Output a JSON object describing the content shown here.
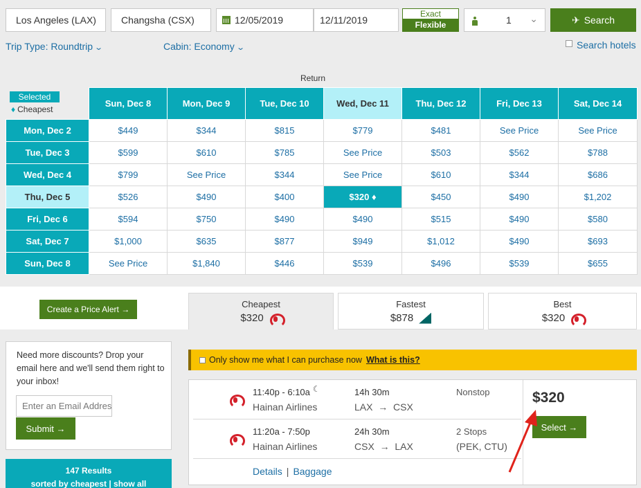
{
  "search": {
    "origin": "Los Angeles (LAX)",
    "destination": "Changsha (CSX)",
    "depart_date": "12/05/2019",
    "return_date": "12/11/2019",
    "exact_label": "Exact",
    "flexible_label": "Flexible",
    "passengers": "1",
    "search_label": "Search"
  },
  "options": {
    "trip_type": "Trip Type: Roundtrip",
    "cabin": "Cabin: Economy",
    "hotels": "Search hotels"
  },
  "grid": {
    "return_label": "Return",
    "selected_label": "Selected",
    "cheapest_label": "Cheapest",
    "columns": [
      "Sun, Dec 8",
      "Mon, Dec 9",
      "Tue, Dec 10",
      "Wed, Dec 11",
      "Thu, Dec 12",
      "Fri, Dec 13",
      "Sat, Dec 14"
    ],
    "rows": [
      {
        "label": "Mon, Dec 2",
        "cells": [
          "$449",
          "$344",
          "$815",
          "$779",
          "$481",
          "See Price",
          "See Price"
        ]
      },
      {
        "label": "Tue, Dec 3",
        "cells": [
          "$599",
          "$610",
          "$785",
          "See Price",
          "$503",
          "$562",
          "$788"
        ]
      },
      {
        "label": "Wed, Dec 4",
        "cells": [
          "$799",
          "See Price",
          "$344",
          "See Price",
          "$610",
          "$344",
          "$686"
        ]
      },
      {
        "label": "Thu, Dec 5",
        "cells": [
          "$526",
          "$490",
          "$400",
          "$320",
          "$450",
          "$490",
          "$1,202"
        ]
      },
      {
        "label": "Fri, Dec 6",
        "cells": [
          "$594",
          "$750",
          "$490",
          "$490",
          "$515",
          "$490",
          "$580"
        ]
      },
      {
        "label": "Sat, Dec 7",
        "cells": [
          "$1,000",
          "$635",
          "$877",
          "$949",
          "$1,012",
          "$490",
          "$693"
        ]
      },
      {
        "label": "Sun, Dec 8",
        "cells": [
          "See Price",
          "$1,840",
          "$446",
          "$539",
          "$496",
          "$539",
          "$655"
        ]
      }
    ]
  },
  "price_alert": "Create a Price Alert",
  "sort_tabs": [
    {
      "label": "Cheapest",
      "price": "$320",
      "logo": "hainan-logo"
    },
    {
      "label": "Fastest",
      "price": "$878",
      "logo": "cathay-logo"
    },
    {
      "label": "Best",
      "price": "$320",
      "logo": "hainan-logo"
    }
  ],
  "discount": {
    "text": "Need more discounts? Drop your email here and we'll send them right to your inbox!",
    "email_placeholder": "Enter an Email Address",
    "submit": "Submit"
  },
  "results": {
    "count": "147 Results",
    "sorted": "sorted by cheapest | show all"
  },
  "purchase": {
    "text": "Only show me what I can purchase now",
    "link": "What is this?"
  },
  "flight": {
    "legs": [
      {
        "time": "11:40p - 6:10a",
        "airline": "Hainan Airlines",
        "duration": "14h 30m",
        "route_from": "LAX",
        "route_to": "CSX",
        "stops": "Nonstop",
        "stops_detail": ""
      },
      {
        "time": "11:20a - 7:50p",
        "airline": "Hainan Airlines",
        "duration": "24h 30m",
        "route_from": "CSX",
        "route_to": "LAX",
        "stops": "2 Stops",
        "stops_detail": "(PEK, CTU)"
      }
    ],
    "details": "Details",
    "baggage": "Baggage",
    "price": "$320",
    "select": "Select"
  },
  "colors": {
    "accent_teal": "#09a9b8",
    "selected_cyan": "#b3f0f8",
    "brand_green": "#4a7f1c",
    "link_blue": "#1c6ea4",
    "notice_yellow": "#f8c200",
    "annotation_red": "#e0231b"
  }
}
